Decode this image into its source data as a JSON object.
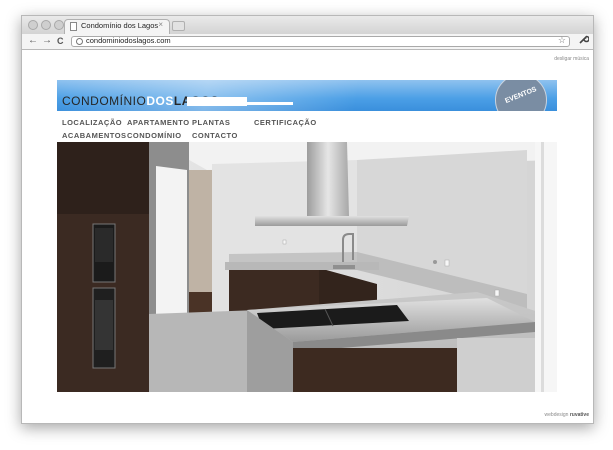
{
  "browser": {
    "tab_title": "Condomínio dos Lagos",
    "tab_close": "×",
    "url": "condominiodoslagos.com",
    "back": "←",
    "forward": "→",
    "reload": "C",
    "star": "☆",
    "wrench": "🔧"
  },
  "page": {
    "music_toggle": "desligar música",
    "logo": {
      "part1": "CONDOMÍNIO",
      "part2": "DOS",
      "part3": "LAGOS"
    },
    "eventos_label": "EVENTOS",
    "nav": [
      "LOCALIZAÇÃO",
      "APARTAMENTO",
      "PLANTAS",
      "CERTIFICAÇÃO",
      "ACABAMENTOS",
      "CONDOMÍNIO",
      "CONTACTO"
    ],
    "credits": {
      "label": "webdesign",
      "studio": "ruvative"
    }
  },
  "colors": {
    "banner": "#4b9fe6",
    "eventos": "#7a8da3"
  }
}
